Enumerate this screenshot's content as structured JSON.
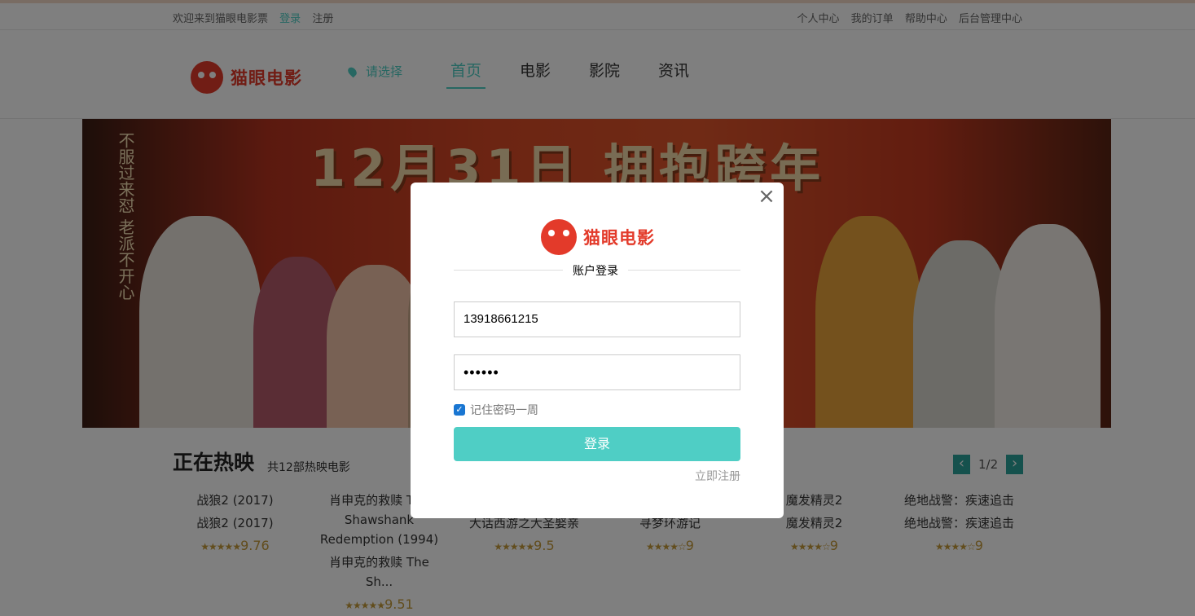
{
  "topbar": {
    "welcome": "欢迎来到猫眼电影票",
    "login": "登录",
    "register": "注册",
    "links": [
      "个人中心",
      "我的订单",
      "帮助中心",
      "后台管理中心"
    ]
  },
  "header": {
    "logo_text": "猫眼电影",
    "city": "请选择",
    "nav": [
      "首页",
      "电影",
      "影院",
      "资讯"
    ]
  },
  "banner": {
    "title": "12月31日 拥抱跨年",
    "side_text": "不服过来怼 老派不开心"
  },
  "section": {
    "title": "正在热映",
    "count": "共12部热映电影",
    "pager": "1/2"
  },
  "movies": [
    {
      "line1": "战狼2 (2017)",
      "line2": "战狼2 (2017)",
      "line3": "",
      "stars": "★★★★★",
      "rating": "9.76"
    },
    {
      "line1": "肖申克的救赎 The",
      "line2": "Shawshank",
      "line3": "Redemption (1994)",
      "line4": "肖申克的救赎 The Sh...",
      "stars": "★★★★★",
      "rating": "9.51"
    },
    {
      "line1": "",
      "line2": "大话西游之大圣娶亲",
      "line3": "",
      "stars": "★★★★★",
      "rating": "9.5"
    },
    {
      "line1": "",
      "line2": "寻梦环游记",
      "line3": "",
      "stars": "★★★★☆",
      "rating": "9"
    },
    {
      "line1": "魔发精灵2",
      "line2": "魔发精灵2",
      "line3": "",
      "stars": "★★★★☆",
      "rating": "9"
    },
    {
      "line1": "绝地战警：疾速追击",
      "line2": "绝地战警：疾速追击",
      "line3": "",
      "stars": "★★★★☆",
      "rating": "9"
    }
  ],
  "modal": {
    "logo_text": "猫眼电影",
    "heading": "账户登录",
    "phone_value": "13918661215",
    "password_value": "••••••",
    "remember_label": "记住密码一周",
    "login_label": "登录",
    "register_label": "立即注册",
    "close": "×"
  },
  "colors": {
    "accent": "#4fcec5",
    "brand": "#e33a2a"
  }
}
